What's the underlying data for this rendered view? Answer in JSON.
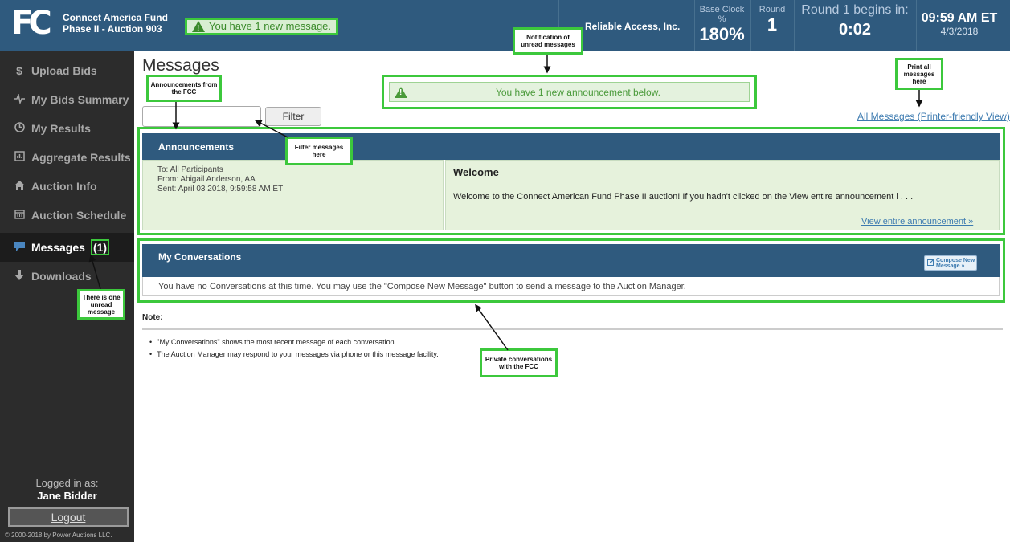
{
  "header": {
    "logo_text": "FC",
    "app_title_line1": "Connect America Fund",
    "app_title_line2": "Phase II - Auction 903",
    "new_message_alert": "You have 1 new message.",
    "company": "Reliable Access, Inc.",
    "base_clock_label": "Base Clock %",
    "base_clock_value": "180%",
    "round_label": "Round",
    "round_value": "1",
    "countdown_label": "Round 1 begins in:",
    "countdown_value": "0:02",
    "time": "09:59 AM ET",
    "date": "4/3/2018"
  },
  "sidebar": {
    "items": [
      {
        "label": "Upload Bids",
        "icon": "dollar-icon"
      },
      {
        "label": "My Bids Summary",
        "icon": "pulse-icon"
      },
      {
        "label": "My Results",
        "icon": "clock-icon"
      },
      {
        "label": "Aggregate Results",
        "icon": "chart-icon"
      },
      {
        "label": "Auction Info",
        "icon": "home-icon"
      },
      {
        "label": "Auction Schedule",
        "icon": "calendar-icon"
      },
      {
        "label": "Messages",
        "count": "(1)",
        "icon": "message-icon"
      },
      {
        "label": "Downloads",
        "icon": "download-icon"
      }
    ],
    "logged_in_label": "Logged in as:",
    "user_name": "Jane Bidder",
    "logout_label": "Logout",
    "copyright": "© 2000-2018 by Power Auctions LLC."
  },
  "main": {
    "title": "Messages",
    "filter_button": "Filter",
    "announcement_alert": "You have 1 new announcement below.",
    "print_link": "All Messages (Printer-friendly View)",
    "announcements": {
      "header": "Announcements",
      "to": "To: All Participants",
      "from": "From: Abigail Anderson, AA",
      "sent": "Sent: April 03 2018,  9:59:58 AM ET",
      "subject": "Welcome",
      "body": "Welcome to the Connect American Fund Phase II auction! If you hadn't clicked on the View entire announcement l . . .",
      "view_link": "View entire announcement »"
    },
    "conversations": {
      "header": "My Conversations",
      "compose_button": "Compose New Message »",
      "empty_text": "You have no Conversations at this time. You may use the \"Compose New Message\" button to send a message to the Auction Manager."
    },
    "note": {
      "title": "Note:",
      "items": [
        "\"My Conversations\" shows the most recent message of each conversation.",
        "The Auction Manager may respond to your messages via phone or this message facility."
      ]
    }
  },
  "callouts": {
    "unread_notification": "Notification of unread messages",
    "announcements_from_fcc": "Announcements from the FCC",
    "filter_messages": "Filter messages here",
    "print_all": "Print all messages here",
    "one_unread": "There is one unread message",
    "private_conversations": "Private conversations with the FCC"
  },
  "colors": {
    "header_blue": "#2f5a7e",
    "sidebar_dark": "#2c2c2c",
    "highlight_green": "#3cc83c",
    "link_blue": "#3d7bb0",
    "announcement_bg": "#e6f2dc"
  }
}
